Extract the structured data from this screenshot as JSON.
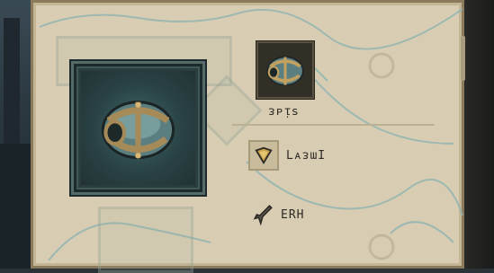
{
  "item": {
    "name": "ᴈᴘᴉꜱ",
    "icon": "bound-orb-icon"
  },
  "stats": [
    {
      "icon": "shield-icon",
      "label": "LᴀᴈɯI"
    },
    {
      "icon": "dagger-icon",
      "label": "ERH"
    }
  ],
  "colors": {
    "parchment": "#d8cdb3",
    "frame_teal": "#2b3d3f",
    "ink": "#2d2a24"
  }
}
